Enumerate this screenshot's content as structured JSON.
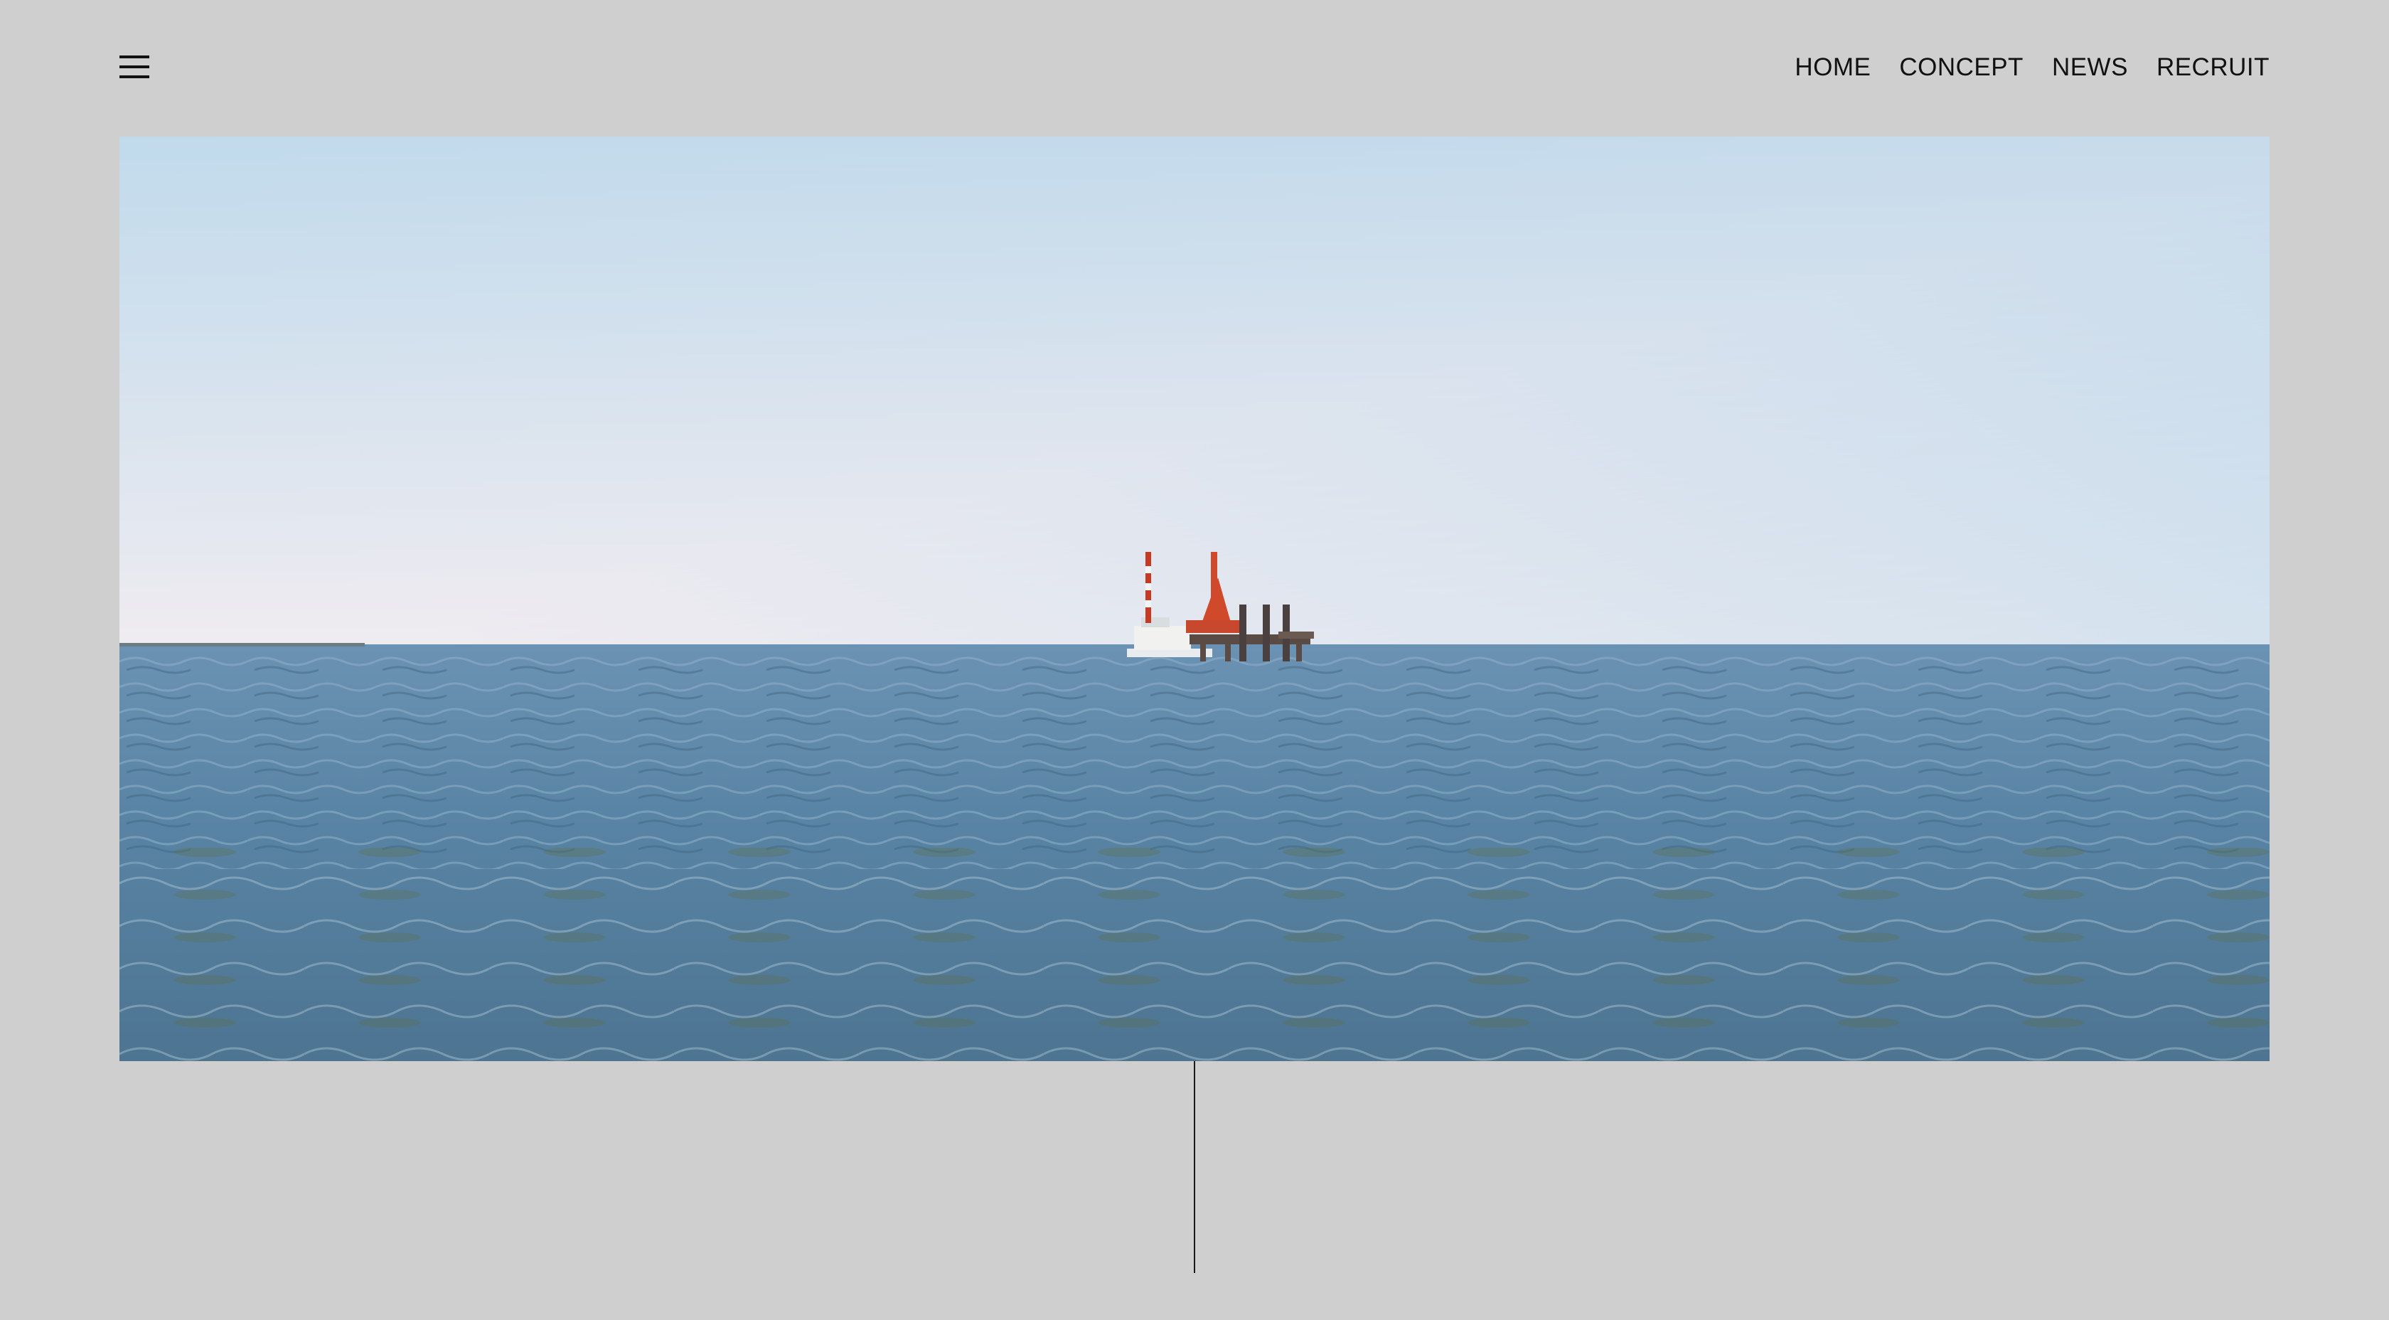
{
  "nav": {
    "menu_icon": "hamburger-icon",
    "items": [
      {
        "label": "HOME"
      },
      {
        "label": "CONCEPT"
      },
      {
        "label": "NEWS"
      },
      {
        "label": "RECRUIT"
      }
    ]
  },
  "hero": {
    "subject": "offshore-platform",
    "colors": {
      "sky_top": "#a9d0e8",
      "sky_bottom": "#ece9ef",
      "sea_top": "#5e87a8",
      "sea_bottom": "#4f7896",
      "platform_accent": "#d0492b"
    }
  },
  "colors": {
    "page_background": "#cfcfcf",
    "text": "#111111"
  }
}
